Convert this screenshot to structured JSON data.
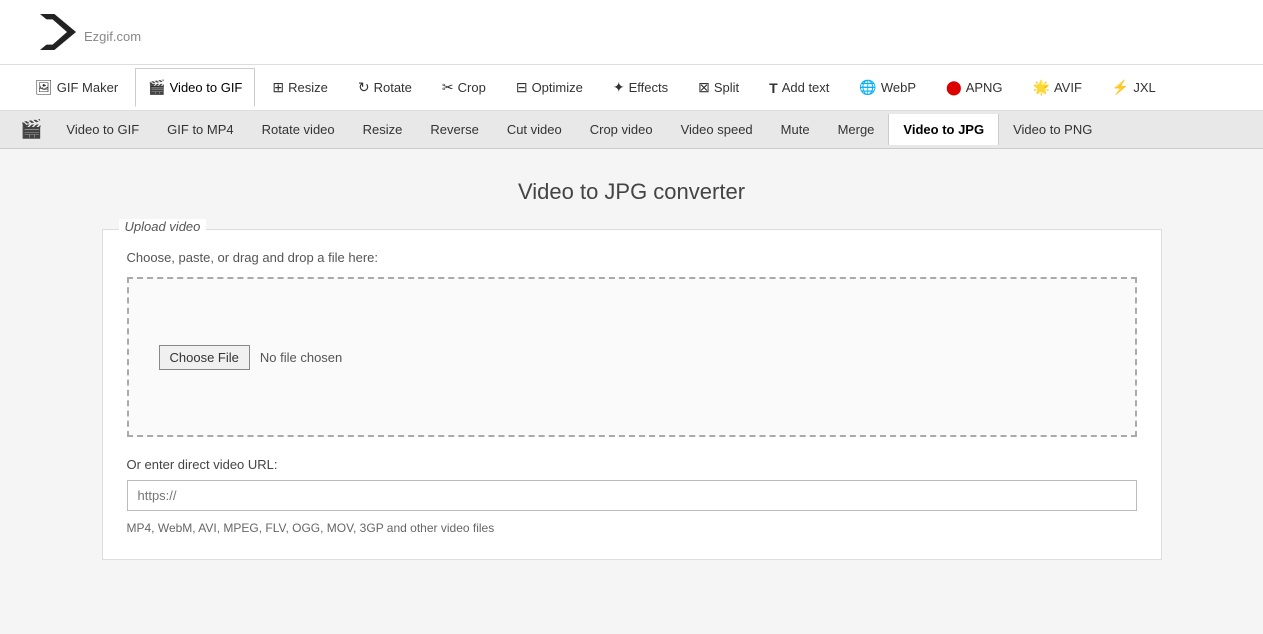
{
  "site": {
    "name": "Ezgif",
    "domain": ".com"
  },
  "main_nav": {
    "items": [
      {
        "id": "gif-maker",
        "label": "GIF Maker",
        "icon": "🖼",
        "active": false
      },
      {
        "id": "video-to-gif",
        "label": "Video to GIF",
        "icon": "🎬",
        "active": true
      },
      {
        "id": "resize",
        "label": "Resize",
        "icon": "⊞",
        "active": false
      },
      {
        "id": "rotate",
        "label": "Rotate",
        "icon": "↻",
        "active": false
      },
      {
        "id": "crop",
        "label": "Crop",
        "icon": "✂",
        "active": false
      },
      {
        "id": "optimize",
        "label": "Optimize",
        "icon": "⊟",
        "active": false
      },
      {
        "id": "effects",
        "label": "Effects",
        "icon": "✦",
        "active": false
      },
      {
        "id": "split",
        "label": "Split",
        "icon": "⊠",
        "active": false
      },
      {
        "id": "add-text",
        "label": "Add text",
        "icon": "T",
        "active": false
      },
      {
        "id": "webp",
        "label": "WebP",
        "icon": "🌐",
        "active": false
      },
      {
        "id": "apng",
        "label": "APNG",
        "icon": "🔴",
        "active": false
      },
      {
        "id": "avif",
        "label": "AVIF",
        "icon": "🌟",
        "active": false
      },
      {
        "id": "jxl",
        "label": "JXL",
        "icon": "⚡",
        "active": false
      }
    ]
  },
  "sub_nav": {
    "items": [
      {
        "id": "video-to-gif",
        "label": "Video to GIF",
        "active": false
      },
      {
        "id": "gif-to-mp4",
        "label": "GIF to MP4",
        "active": false
      },
      {
        "id": "rotate-video",
        "label": "Rotate video",
        "active": false
      },
      {
        "id": "resize",
        "label": "Resize",
        "active": false
      },
      {
        "id": "reverse",
        "label": "Reverse",
        "active": false
      },
      {
        "id": "cut-video",
        "label": "Cut video",
        "active": false
      },
      {
        "id": "crop-video",
        "label": "Crop video",
        "active": false
      },
      {
        "id": "video-speed",
        "label": "Video speed",
        "active": false
      },
      {
        "id": "mute",
        "label": "Mute",
        "active": false
      },
      {
        "id": "merge",
        "label": "Merge",
        "active": false
      },
      {
        "id": "video-to-jpg",
        "label": "Video to JPG",
        "active": true
      },
      {
        "id": "video-to-png",
        "label": "Video to PNG",
        "active": false
      }
    ]
  },
  "page": {
    "title": "Video to JPG converter"
  },
  "upload_section": {
    "card_label": "Upload video",
    "instruction": "Choose, paste, or drag and drop a file here:",
    "choose_file_label": "Choose File",
    "no_file_text": "No file chosen",
    "url_label": "Or enter direct video URL:",
    "url_placeholder": "https://",
    "file_types": "MP4, WebM, AVI, MPEG, FLV, OGG, MOV, 3GP and other video files"
  }
}
